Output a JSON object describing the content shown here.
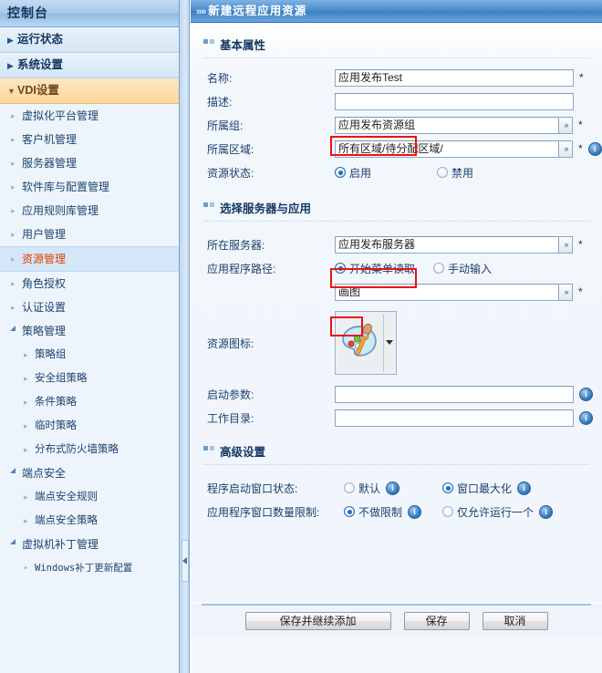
{
  "sidebar": {
    "title": "控制台",
    "groups": [
      {
        "label": "运行状态",
        "state": "collapsed"
      },
      {
        "label": "系统设置",
        "state": "collapsed"
      },
      {
        "label": "VDI设置",
        "state": "expanded"
      }
    ],
    "items": [
      {
        "label": "虚拟化平台管理",
        "level": 1,
        "selected": false,
        "marker": "bullet"
      },
      {
        "label": "客户机管理",
        "level": 1,
        "selected": false,
        "marker": "bullet"
      },
      {
        "label": "服务器管理",
        "level": 1,
        "selected": false,
        "marker": "bullet"
      },
      {
        "label": "软件库与配置管理",
        "level": 1,
        "selected": false,
        "marker": "bullet"
      },
      {
        "label": "应用规则库管理",
        "level": 1,
        "selected": false,
        "marker": "bullet"
      },
      {
        "label": "用户管理",
        "level": 1,
        "selected": false,
        "marker": "bullet"
      },
      {
        "label": "资源管理",
        "level": 1,
        "selected": true,
        "marker": "bullet"
      },
      {
        "label": "角色授权",
        "level": 1,
        "selected": false,
        "marker": "bullet"
      },
      {
        "label": "认证设置",
        "level": 1,
        "selected": false,
        "marker": "bullet"
      },
      {
        "label": "策略管理",
        "level": 1,
        "selected": false,
        "marker": "triangle"
      },
      {
        "label": "策略组",
        "level": 2,
        "selected": false,
        "marker": "bullet"
      },
      {
        "label": "安全组策略",
        "level": 2,
        "selected": false,
        "marker": "bullet"
      },
      {
        "label": "条件策略",
        "level": 2,
        "selected": false,
        "marker": "bullet"
      },
      {
        "label": "临时策略",
        "level": 2,
        "selected": false,
        "marker": "bullet"
      },
      {
        "label": "分布式防火墙策略",
        "level": 2,
        "selected": false,
        "marker": "bullet"
      },
      {
        "label": "端点安全",
        "level": 1,
        "selected": false,
        "marker": "triangle"
      },
      {
        "label": "端点安全规则",
        "level": 2,
        "selected": false,
        "marker": "bullet"
      },
      {
        "label": "端点安全策略",
        "level": 2,
        "selected": false,
        "marker": "bullet"
      },
      {
        "label": "虚拟机补丁管理",
        "level": 1,
        "selected": false,
        "marker": "triangle"
      },
      {
        "label": "Windows补丁更新配置",
        "level": 2,
        "selected": false,
        "marker": "bullet",
        "mono": true
      }
    ]
  },
  "main": {
    "header_title": "新建远程应用资源",
    "sections": {
      "basic": {
        "title": "基本属性",
        "name_label": "名称:",
        "name_value": "应用发布Test",
        "desc_label": "描述:",
        "desc_value": "",
        "group_label": "所属组:",
        "group_value": "应用发布资源组",
        "area_label": "所属区域:",
        "area_value": "所有区域/待分配区域/",
        "status_label": "资源状态:",
        "status_enable": "启用",
        "status_disable": "禁用",
        "status_selected": "启用"
      },
      "server": {
        "title": "选择服务器与应用",
        "server_label": "所在服务器:",
        "server_value": "应用发布服务器",
        "path_label": "应用程序路径:",
        "path_mode_menu": "开始菜单读取",
        "path_mode_manual": "手动输入",
        "path_mode_selected": "开始菜单读取",
        "path_value": "画图",
        "icon_label": "资源图标:",
        "icon_name": "paint-palette-icon",
        "startparam_label": "启动参数:",
        "startparam_value": "",
        "workdir_label": "工作目录:",
        "workdir_value": ""
      },
      "advanced": {
        "title": "高级设置",
        "winstate_label": "程序启动窗口状态:",
        "winstate_default": "默认",
        "winstate_maximized": "窗口最大化",
        "winstate_selected": "窗口最大化",
        "winlimit_label": "应用程序窗口数量限制:",
        "winlimit_none": "不做限制",
        "winlimit_single": "仅允许运行一个",
        "winlimit_selected": "不做限制"
      }
    },
    "footer": {
      "save_continue": "保存并继续添加",
      "save": "保存",
      "cancel": "取消"
    },
    "required_mark": "*",
    "info_mark": "i",
    "picker_glyph": "»"
  },
  "colors": {
    "accent": "#3f82c2",
    "selected_text": "#dd4400",
    "highlight_box": "#ee1111",
    "group_open_bg": "#fbd79c"
  }
}
